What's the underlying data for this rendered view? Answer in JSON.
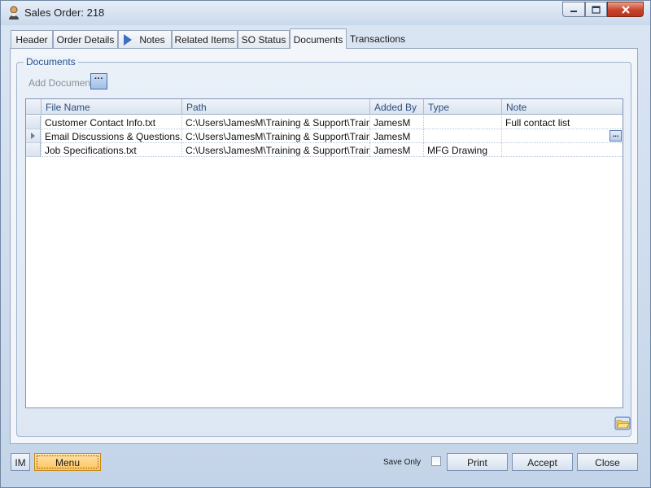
{
  "window": {
    "title": "Sales Order: 218",
    "app_icon": "user-icon",
    "controls": [
      "minimize-icon",
      "maximize-icon",
      "close-icon"
    ]
  },
  "tabs": [
    {
      "label": "Header"
    },
    {
      "label": "Order Details"
    },
    {
      "label": "Notes"
    },
    {
      "label": "Related Items"
    },
    {
      "label": "SO Status"
    },
    {
      "label": "Documents"
    },
    {
      "label": "Transactions"
    }
  ],
  "active_tab": "Documents",
  "documents": {
    "group_title": "Documents",
    "add_label": "Add Document",
    "add_button_label": "···",
    "columns": [
      "File Name",
      "Path",
      "Added By",
      "Type",
      "Note"
    ],
    "rows": [
      {
        "file_name": "Customer Contact Info.txt",
        "path": "C:\\Users\\JamesM\\Training & Support\\Traini...",
        "added_by": "JamesM",
        "type": "",
        "note": "Full contact list"
      },
      {
        "file_name": "Email Discussions & Questions.txt",
        "path": "C:\\Users\\JamesM\\Training & Support\\Traini...",
        "added_by": "JamesM",
        "type": "",
        "note": ""
      },
      {
        "file_name": "Job Specifications.txt",
        "path": "C:\\Users\\JamesM\\Training & Support\\Traini...",
        "added_by": "JamesM",
        "type": "MFG Drawing",
        "note": ""
      }
    ],
    "cell_button_label": "...",
    "open_icon": "open-folder-icon"
  },
  "footer": {
    "im_label": "IM",
    "menu_label": "Menu",
    "save_only_label": "Save Only",
    "print_label": "Print",
    "accept_label": "Accept",
    "close_label": "Close"
  },
  "colors": {
    "accent": "#3d6fc1",
    "menu_button": "#ffc45e",
    "close_button": "#c7442c"
  }
}
